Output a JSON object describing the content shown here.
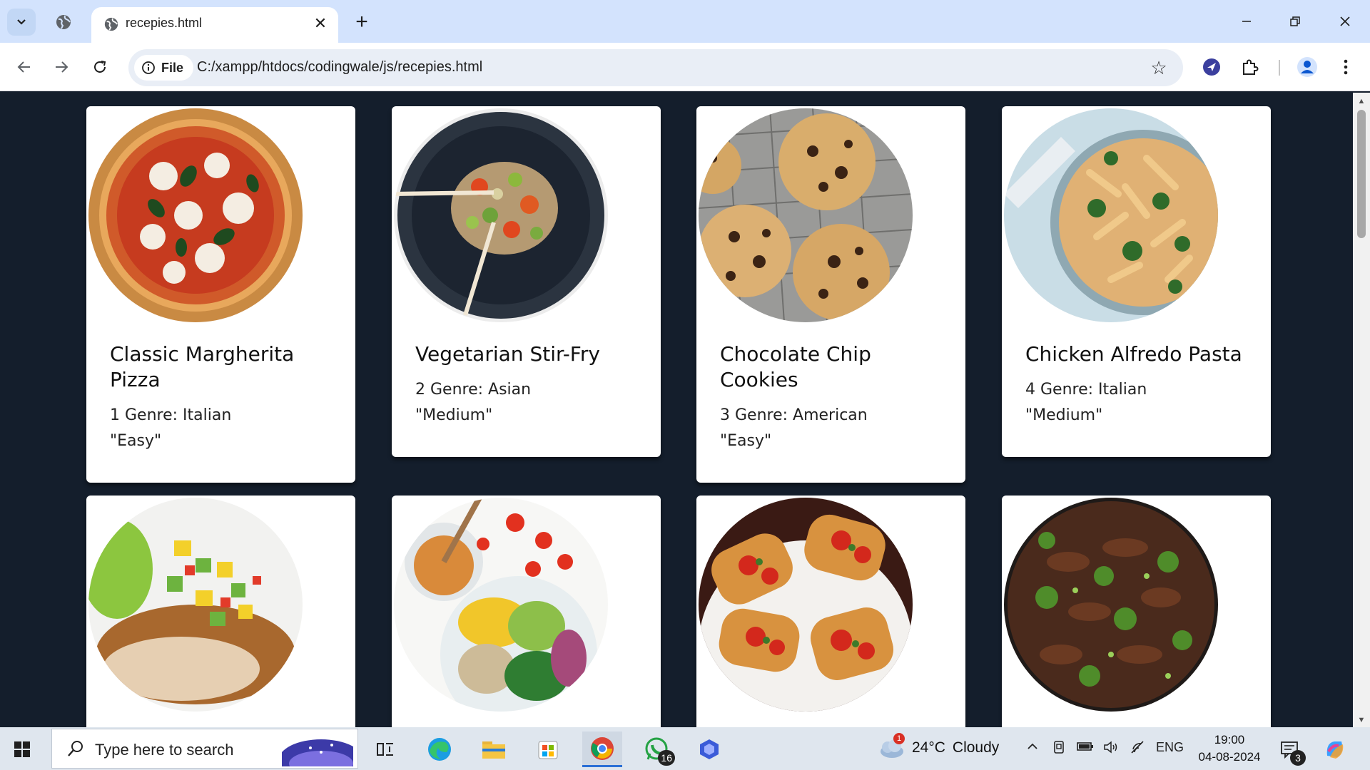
{
  "browser": {
    "tab_title": "recepies.html",
    "chip_label": "File",
    "url": "C:/xampp/htdocs/codingwale/js/recepies.html"
  },
  "recipes": [
    {
      "title": "Classic Margherita Pizza",
      "genre": "1 Genre: Italian",
      "difficulty": "\"Easy\""
    },
    {
      "title": "Vegetarian Stir-Fry",
      "genre": "2 Genre: Asian",
      "difficulty": "\"Medium\""
    },
    {
      "title": "Chocolate Chip Cookies",
      "genre": "3 Genre: American",
      "difficulty": "\"Easy\""
    },
    {
      "title": "Chicken Alfredo Pasta",
      "genre": "4 Genre: Italian",
      "difficulty": "\"Medium\""
    }
  ],
  "taskbar": {
    "search_placeholder": "Type here to search",
    "weather_temp": "24°C",
    "weather_text": "Cloudy",
    "weather_badge": "1",
    "language": "ENG",
    "time": "19:00",
    "date": "04-08-2024",
    "whatsapp_badge": "16",
    "notifications_badge": "3"
  },
  "colors": {
    "page_background": "#141e2c",
    "tab_strip": "#d3e3fd",
    "card_background": "#ffffff"
  }
}
